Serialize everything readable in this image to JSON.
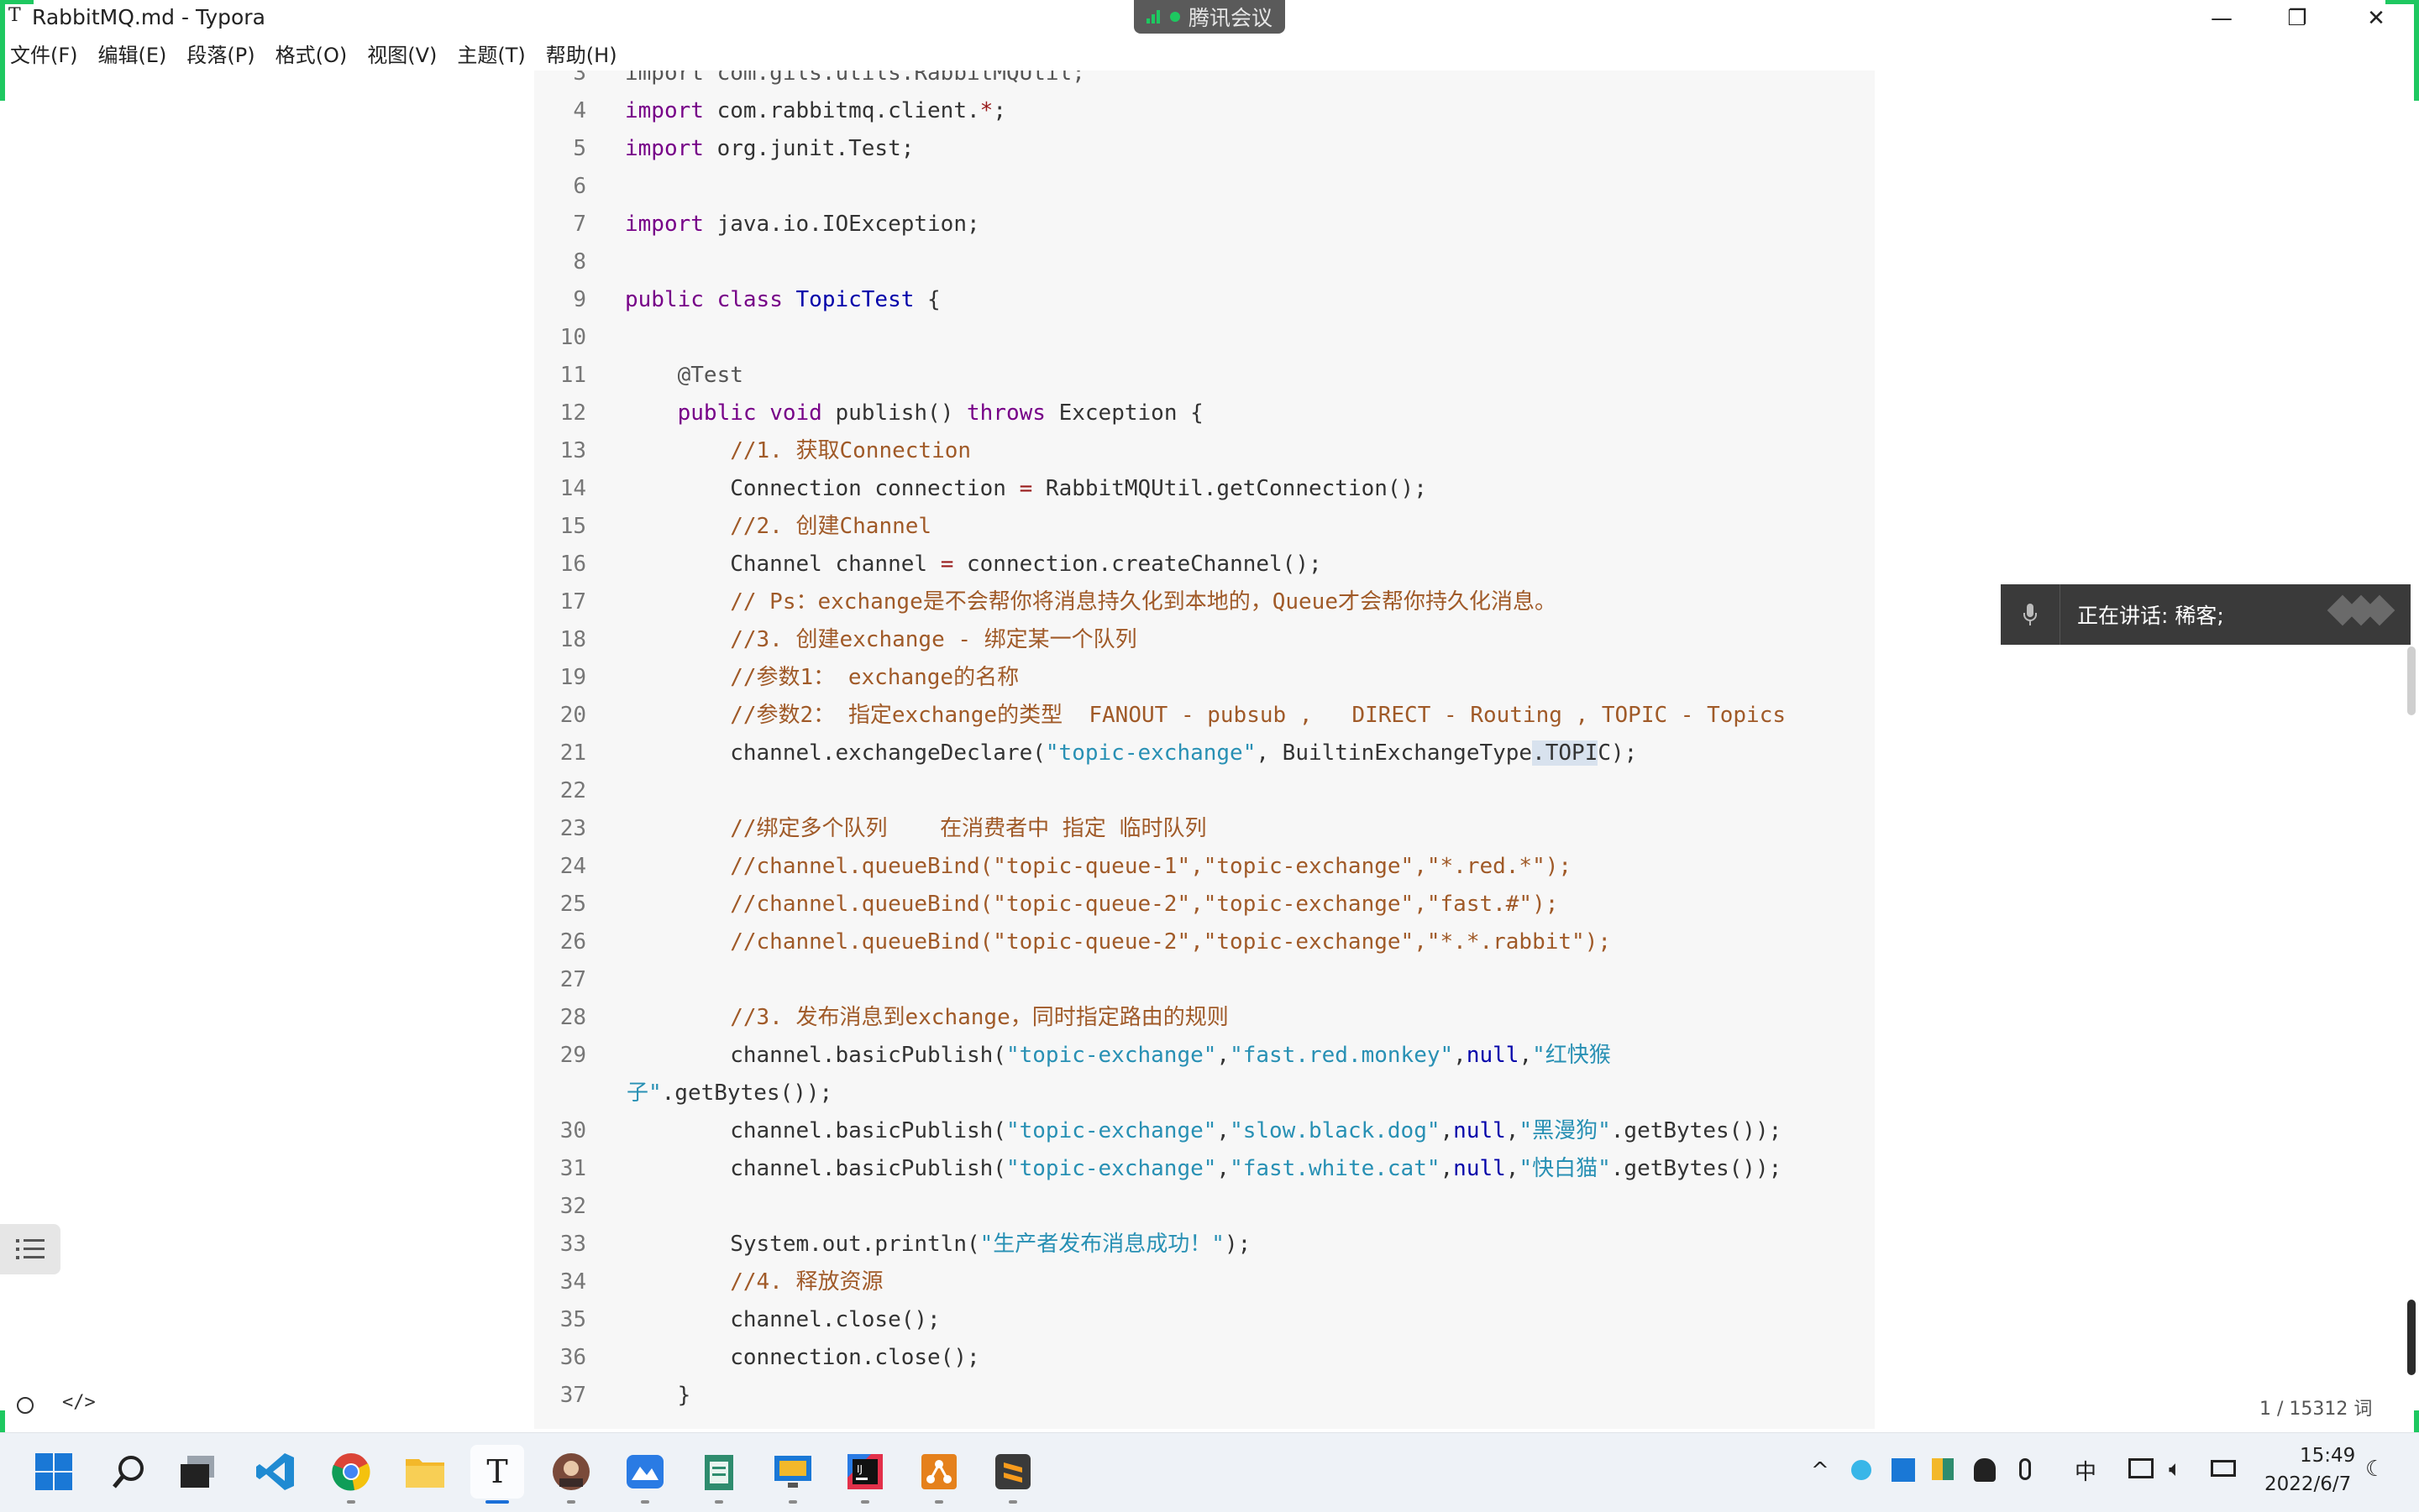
{
  "window": {
    "app_icon": "T",
    "title": "RabbitMQ.md - Typora",
    "minimize": "—",
    "maximize": "❐",
    "close": "✕"
  },
  "meeting_badge": "腾讯会议",
  "menu": [
    "文件(F)",
    "编辑(E)",
    "段落(P)",
    "格式(O)",
    "视图(V)",
    "主题(T)",
    "帮助(H)"
  ],
  "code_lines": [
    {
      "n": "3",
      "segs": [
        {
          "t": "import com.gils.utils.RabbitMQUtil;",
          "c": "a"
        }
      ]
    },
    {
      "n": "4",
      "segs": [
        {
          "t": "import",
          "c": "k"
        },
        {
          "t": " com.rabbitmq.client."
        },
        {
          "t": "*",
          "c": "o"
        },
        {
          "t": ";"
        }
      ]
    },
    {
      "n": "5",
      "segs": [
        {
          "t": "import",
          "c": "k"
        },
        {
          "t": " org.junit.Test;"
        }
      ]
    },
    {
      "n": "6",
      "segs": []
    },
    {
      "n": "7",
      "segs": [
        {
          "t": "import",
          "c": "k"
        },
        {
          "t": " java.io.IOException;"
        }
      ]
    },
    {
      "n": "8",
      "segs": []
    },
    {
      "n": "9",
      "segs": [
        {
          "t": "public",
          "c": "k"
        },
        {
          "t": " "
        },
        {
          "t": "class",
          "c": "k"
        },
        {
          "t": " "
        },
        {
          "t": "TopicTest",
          "c": "d"
        },
        {
          "t": " {"
        }
      ]
    },
    {
      "n": "10",
      "segs": []
    },
    {
      "n": "11",
      "segs": [
        {
          "t": "    @Test",
          "c": "a"
        }
      ]
    },
    {
      "n": "12",
      "segs": [
        {
          "t": "    "
        },
        {
          "t": "public",
          "c": "k"
        },
        {
          "t": " "
        },
        {
          "t": "void",
          "c": "k"
        },
        {
          "t": " publish() "
        },
        {
          "t": "throws",
          "c": "k"
        },
        {
          "t": " Exception {"
        }
      ]
    },
    {
      "n": "13",
      "segs": [
        {
          "t": "        //1. 获取Connection",
          "c": "c"
        }
      ]
    },
    {
      "n": "14",
      "segs": [
        {
          "t": "        Connection connection "
        },
        {
          "t": "=",
          "c": "o"
        },
        {
          "t": " RabbitMQUtil.getConnection();"
        }
      ]
    },
    {
      "n": "15",
      "segs": [
        {
          "t": "        //2. 创建Channel",
          "c": "c"
        }
      ]
    },
    {
      "n": "16",
      "segs": [
        {
          "t": "        Channel channel "
        },
        {
          "t": "=",
          "c": "o"
        },
        {
          "t": " connection.createChannel();"
        }
      ]
    },
    {
      "n": "17",
      "segs": [
        {
          "t": "        // Ps：exchange是不会帮你将消息持久化到本地的，Queue才会帮你持久化消息。",
          "c": "c"
        }
      ]
    },
    {
      "n": "18",
      "segs": [
        {
          "t": "        //3. 创建exchange - 绑定某一个队列",
          "c": "c"
        }
      ]
    },
    {
      "n": "19",
      "segs": [
        {
          "t": "        //参数1： exchange的名称",
          "c": "c"
        }
      ]
    },
    {
      "n": "20",
      "segs": [
        {
          "t": "        //参数2： 指定exchange的类型  FANOUT - pubsub ,   DIRECT - Routing , TOPIC - Topics",
          "c": "c"
        }
      ]
    },
    {
      "n": "21",
      "segs": [
        {
          "t": "        channel.exchangeDeclare("
        },
        {
          "t": "\"topic-exchange\"",
          "c": "s"
        },
        {
          "t": ", BuiltinExchangeType"
        },
        {
          "t": ".TOPI",
          "sel": true
        },
        {
          "t": "C);"
        }
      ]
    },
    {
      "n": "22",
      "segs": []
    },
    {
      "n": "23",
      "segs": [
        {
          "t": "        //绑定多个队列    在消费者中 指定 临时队列",
          "c": "c"
        }
      ]
    },
    {
      "n": "24",
      "segs": [
        {
          "t": "        //channel.queueBind(\"topic-queue-1\",\"topic-exchange\",\"*.red.*\");",
          "c": "c"
        }
      ]
    },
    {
      "n": "25",
      "segs": [
        {
          "t": "        //channel.queueBind(\"topic-queue-2\",\"topic-exchange\",\"fast.#\");",
          "c": "c"
        }
      ]
    },
    {
      "n": "26",
      "segs": [
        {
          "t": "        //channel.queueBind(\"topic-queue-2\",\"topic-exchange\",\"*.*.rabbit\");",
          "c": "c"
        }
      ]
    },
    {
      "n": "27",
      "segs": []
    },
    {
      "n": "28",
      "segs": [
        {
          "t": "        //3. 发布消息到exchange，同时指定路由的规则",
          "c": "c"
        }
      ]
    },
    {
      "n": "29",
      "segs": [
        {
          "t": "        channel.basicPublish("
        },
        {
          "t": "\"topic-exchange\"",
          "c": "s"
        },
        {
          "t": ","
        },
        {
          "t": "\"fast.red.monkey\"",
          "c": "s"
        },
        {
          "t": ","
        },
        {
          "t": "null",
          "c": "d"
        },
        {
          "t": ","
        },
        {
          "t": "\"红快猴",
          "c": "s"
        }
      ]
    },
    {
      "n": "",
      "segs": [
        {
          "t": "子\"",
          "c": "s"
        },
        {
          "t": ".getBytes());"
        }
      ],
      "wrap": true
    },
    {
      "n": "30",
      "segs": [
        {
          "t": "        channel.basicPublish("
        },
        {
          "t": "\"topic-exchange\"",
          "c": "s"
        },
        {
          "t": ","
        },
        {
          "t": "\"slow.black.dog\"",
          "c": "s"
        },
        {
          "t": ","
        },
        {
          "t": "null",
          "c": "d"
        },
        {
          "t": ","
        },
        {
          "t": "\"黑漫狗\"",
          "c": "s"
        },
        {
          "t": ".getBytes());"
        }
      ]
    },
    {
      "n": "31",
      "segs": [
        {
          "t": "        channel.basicPublish("
        },
        {
          "t": "\"topic-exchange\"",
          "c": "s"
        },
        {
          "t": ","
        },
        {
          "t": "\"fast.white.cat\"",
          "c": "s"
        },
        {
          "t": ","
        },
        {
          "t": "null",
          "c": "d"
        },
        {
          "t": ","
        },
        {
          "t": "\"快白猫\"",
          "c": "s"
        },
        {
          "t": ".getBytes());"
        }
      ]
    },
    {
      "n": "32",
      "segs": []
    },
    {
      "n": "33",
      "segs": [
        {
          "t": "        System.out.println("
        },
        {
          "t": "\"生产者发布消息成功！\"",
          "c": "s"
        },
        {
          "t": ");"
        }
      ]
    },
    {
      "n": "34",
      "segs": [
        {
          "t": "        //4. 释放资源",
          "c": "c"
        }
      ]
    },
    {
      "n": "35",
      "segs": [
        {
          "t": "        channel.close();"
        }
      ]
    },
    {
      "n": "36",
      "segs": [
        {
          "t": "        connection.close();"
        }
      ]
    },
    {
      "n": "37",
      "segs": [
        {
          "t": "    }"
        }
      ]
    }
  ],
  "word_count": "1 / 15312 词",
  "speaking": {
    "label": "正在讲话: 稀客;"
  },
  "taskbar": {
    "apps": [
      "start-icon",
      "search-icon",
      "task-view-icon",
      "vscode-icon",
      "chrome-icon",
      "file-explorer-icon",
      "typora-icon",
      "avatar-app-icon",
      "feishu-icon",
      "notepad-icon",
      "remote-desktop-icon",
      "intellij-icon",
      "sourcetree-icon",
      "sublime-icon"
    ],
    "tray_caret": "^",
    "ime": "中",
    "time": "15:49",
    "date": "2022/6/7"
  },
  "colors": {
    "accent": "#1ec860",
    "keyword": "#770088",
    "string": "#2890b4",
    "comment": "#a05a28"
  }
}
